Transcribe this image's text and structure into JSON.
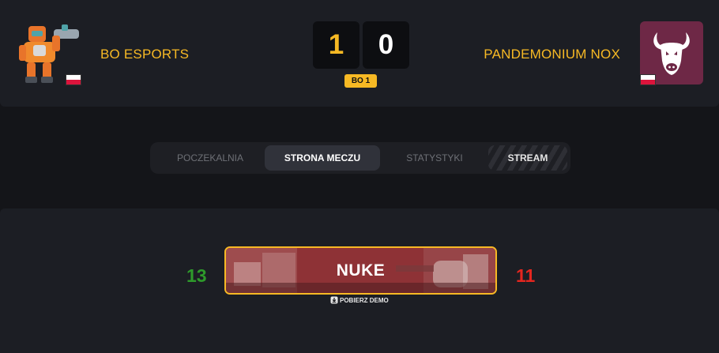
{
  "match": {
    "best_of": "BO 1",
    "team_left": {
      "name": "BO ESPORTS",
      "score": "1",
      "flag": "poland-flag"
    },
    "team_right": {
      "name": "PANDEMONIUM NOX",
      "score": "0",
      "flag": "poland-flag"
    }
  },
  "tabs": [
    {
      "label": "POCZEKALNIA",
      "active": false
    },
    {
      "label": "STRONA MECZU",
      "active": true
    },
    {
      "label": "STATYSTYKI",
      "active": false
    },
    {
      "label": "STREAM",
      "active": false
    }
  ],
  "map": {
    "name": "NUKE",
    "score_left": "13",
    "score_right": "11",
    "demo_label": "POBIERZ DEMO"
  },
  "colors": {
    "accent": "#f7b924",
    "win": "#2e9a2b",
    "loss": "#e4261f",
    "background": "#141519",
    "panel": "#1c1e24"
  },
  "icons": [
    "robot-mascot-logo",
    "bull-head-logo",
    "poland-flag",
    "download-icon"
  ]
}
